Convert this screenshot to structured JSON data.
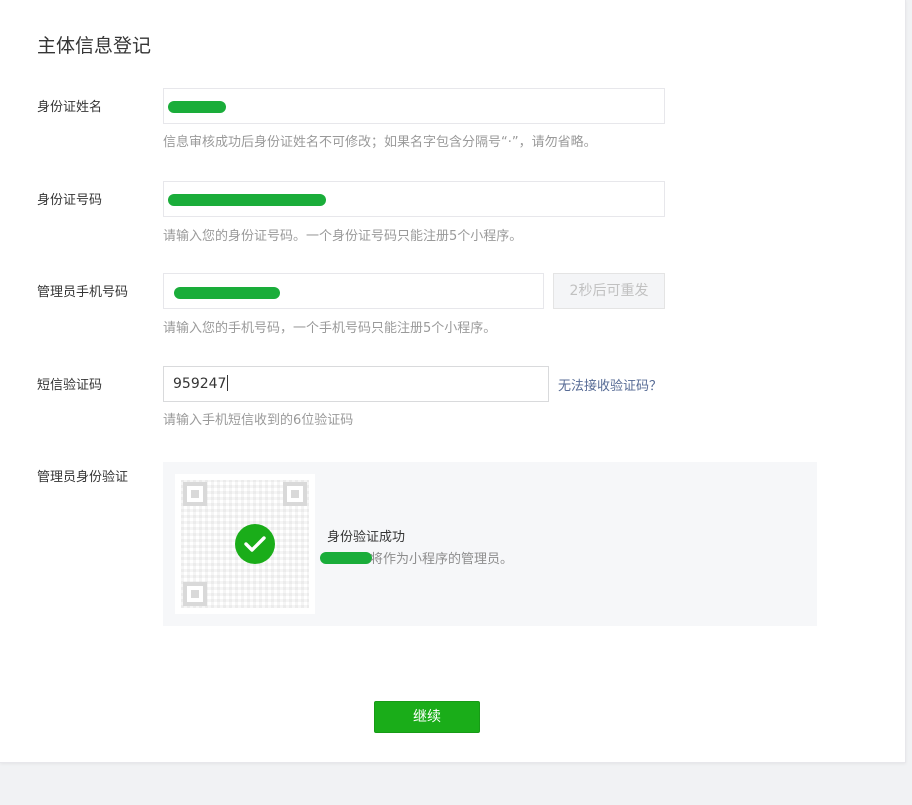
{
  "page": {
    "title": "主体信息登记"
  },
  "form": {
    "id_name": {
      "label": "身份证姓名",
      "hint": "信息审核成功后身份证姓名不可修改；如果名字包含分隔号“·”，请勿省略。"
    },
    "id_number": {
      "label": "身份证号码",
      "hint": "请输入您的身份证号码。一个身份证号码只能注册5个小程序。"
    },
    "admin_phone": {
      "label": "管理员手机号码",
      "resend_label": "2秒后可重发",
      "hint": "请输入您的手机号码，一个手机号码只能注册5个小程序。"
    },
    "sms_code": {
      "label": "短信验证码",
      "value": "959247",
      "help_link": "无法接收验证码？",
      "hint": "请输入手机短信收到的6位验证码"
    },
    "admin_verify": {
      "label": "管理员身份验证",
      "status_title": "身份验证成功",
      "status_desc": "将作为小程序的管理员。"
    }
  },
  "actions": {
    "continue_label": "继续"
  },
  "colors": {
    "brand_green": "#1aad19",
    "link_blue": "#576b95",
    "redaction_green": "#1aad3a"
  },
  "icons": {
    "success": "check-icon"
  }
}
